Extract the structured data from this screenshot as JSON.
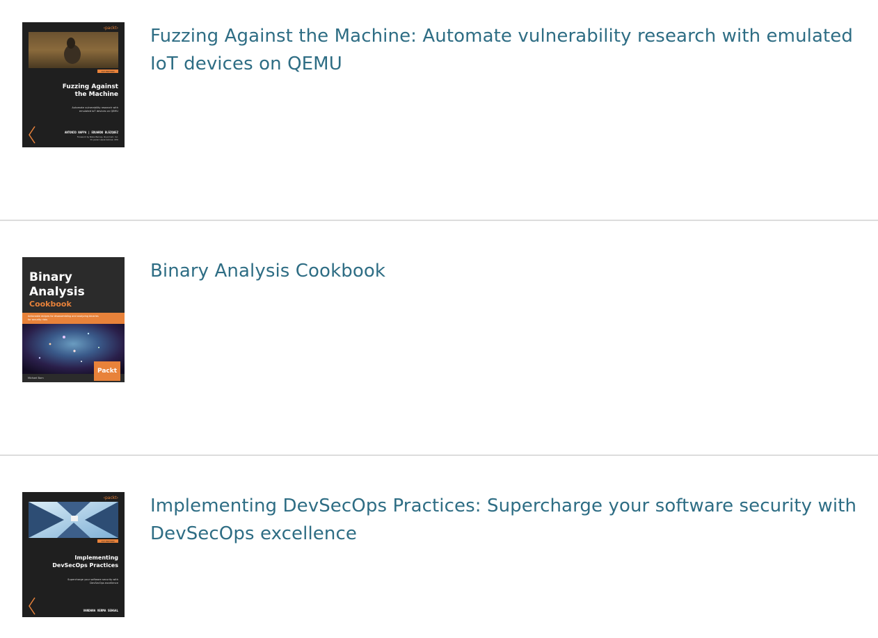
{
  "books": [
    {
      "title": "Fuzzing Against the Machine: Automate vulnerability research with emulated IoT devices on QEMU",
      "cover": {
        "publisher_mark": "‹packt›",
        "edition": "1ST EDITION",
        "heading_line1": "Fuzzing Against",
        "heading_line2": "the Machine",
        "subtitle_line1": "Automate vulnerability research with",
        "subtitle_line2": "emulated IoT devices on QEMU",
        "authors": "ANTONIO NAPPA | EDUARDO BLÁZQUEZ",
        "foreword_line1": "Foreword by Nikos Barnes, Ilnyorrium, Inc.",
        "foreword_line2": "Dr. Javier López-Gómez, CEO"
      }
    },
    {
      "title": "Binary Analysis Cookbook",
      "cover": {
        "heading_line1": "Binary",
        "heading_line2": "Analysis",
        "heading_line3": "Cookbook",
        "tagline_line1": "Actionable recipes for disassembling and analyzing binaries",
        "tagline_line2": "for security risks",
        "publisher_mark": "Packt",
        "author": "Michael Born"
      }
    },
    {
      "title": "Implementing DevSecOps Practices: Supercharge your software security with DevSecOps excellence",
      "cover": {
        "publisher_mark": "‹packt›",
        "edition": "1ST EDITION",
        "heading_line1": "Implementing",
        "heading_line2": "DevSecOps Practices",
        "subtitle_line1": "Supercharge your software security with",
        "subtitle_line2": "DevSecOps excellence",
        "author": "VANDANA VERMA SEHGAL"
      }
    }
  ],
  "colors": {
    "link": "#2e6d84",
    "divider": "#dcdcdc",
    "cover_dark": "#1f1f1f",
    "accent_orange": "#e8823a"
  }
}
